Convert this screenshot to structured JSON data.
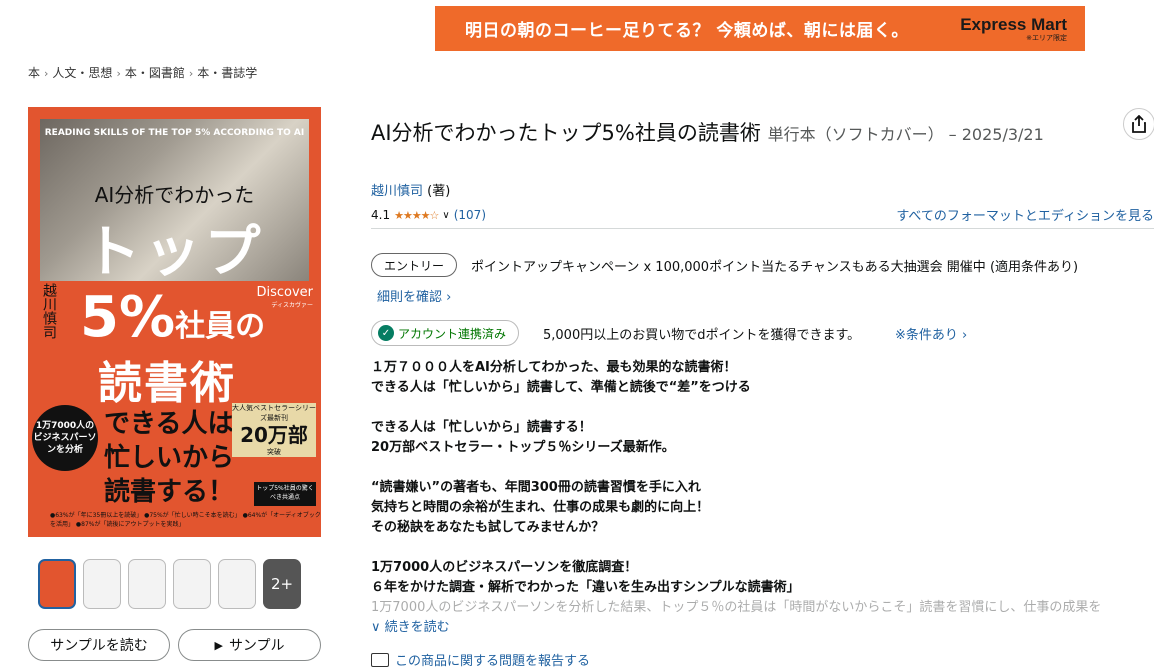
{
  "banner": {
    "text": "明日の朝のコーヒー足りてる？ 今頼めば、朝には届く。",
    "logo": "Express Mart",
    "logo_sub": "※エリア限定"
  },
  "breadcrumbs": [
    "本",
    "人文・思想",
    "本・図書館",
    "本・書誌学"
  ],
  "cover": {
    "en_title": "READING SKILLS OF THE TOP 5% ACCORDING TO AI",
    "ai_line": "AI分析でわかった",
    "top": "トップ",
    "five_percent": "5%",
    "shain": "社員の",
    "read": "読書術",
    "author": "越川慎司",
    "publisher": "Discover",
    "publisher_sub": "ディスカヴァー",
    "circle": "1万7000人のビジネスパーソンを分析",
    "main_copy": "できる人は忙しいから読書する！",
    "badge_top": "大人気ベストセラーシリーズ最新刊",
    "badge_big": "20万部",
    "badge_bottom": "突破",
    "badge2": "トップ5%社員の驚くべき共通点",
    "foot": "●63%が「年に35冊以上を読破」 ●75%が「忙しい時こそ本を読む」 ●64%が「オーディオブックを活用」 ●87%が「読後にアウトプットを実践」"
  },
  "thumb_more": "2+",
  "buttons": {
    "read_sample": "サンプルを読む",
    "sample": "サンプル"
  },
  "product": {
    "title": "AI分析でわかったトップ5%社員の読書術",
    "format": "単行本（ソフトカバー） – 2025/3/21",
    "author": "越川慎司",
    "author_role": "(著)",
    "rating": "4.1",
    "stars": 4.1,
    "count": "(107)",
    "all_formats": "すべてのフォーマットとエディションを見る"
  },
  "promo": {
    "tag": "エントリー",
    "text": "ポイントアップキャンペーン x 100,000ポイント当たるチャンスもある大抽選会 開催中 (適用条件あり)",
    "details": "細則を確認"
  },
  "account": {
    "label": "アカウント連携済み",
    "text": "5,000円以上のお買い物でdポイントを獲得できます。",
    "conditions": "※条件あり"
  },
  "description": [
    "１万７０００人をAI分析してわかった、最も効果的な読書術！",
    "できる人は「忙しいから」読書して、準備と読後で“差”をつける",
    "",
    "できる人は「忙しいから」読書する！",
    "20万部ベストセラー・トップ５％シリーズ最新作。",
    "",
    "“読書嫌い”の著者も、年間300冊の読書習慣を手に入れ",
    "気持ちと時間の余裕が生まれ、仕事の成果も劇的に向上！",
    "その秘訣をあなたも試してみませんか？",
    "",
    "1万7000人のビジネスパーソンを徹底調査！",
    "６年をかけた調査・解析でわかった「違いを生み出すシンプルな読書術」"
  ],
  "description_fade": "1万7000人のビジネスパーソンを分析した結果、トップ５％の社員は「時間がないからこそ」読書を習慣にし、仕事の成果を",
  "read_more": "続きを読む",
  "report": "この商品に関する問題を報告する"
}
